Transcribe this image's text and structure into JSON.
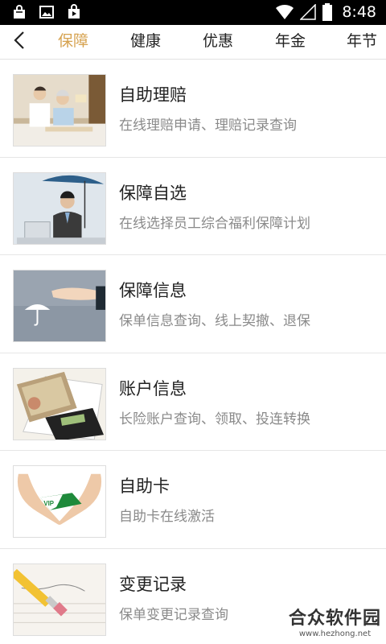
{
  "status_bar": {
    "time": "8:48",
    "left_icons": [
      "bag-icon",
      "image-icon",
      "play-store-icon"
    ],
    "right_icons": [
      "wifi-icon",
      "signal-icon",
      "battery-icon"
    ]
  },
  "nav": {
    "back_icon": "chevron-left-icon",
    "tabs": [
      {
        "label": "保障",
        "active": true
      },
      {
        "label": "健康",
        "active": false
      },
      {
        "label": "优惠",
        "active": false
      },
      {
        "label": "年金",
        "active": false
      },
      {
        "label": "年节",
        "active": false
      }
    ],
    "accent_color": "#d6a24f"
  },
  "items": [
    {
      "title": "自助理赔",
      "subtitle": "在线理赔申请、理赔记录查询",
      "image": "elderly-couple-photo"
    },
    {
      "title": "保障自选",
      "subtitle": "在线选择员工综合福利保障计划",
      "image": "businessman-umbrella-photo"
    },
    {
      "title": "保障信息",
      "subtitle": "保单信息查询、线上契撤、退保",
      "image": "hand-umbrella-photo"
    },
    {
      "title": "账户信息",
      "subtitle": "长险账户查询、领取、投连转换",
      "image": "cash-calculator-photo"
    },
    {
      "title": "自助卡",
      "subtitle": "自助卡在线激活",
      "image": "hands-vip-card-photo"
    },
    {
      "title": "变更记录",
      "subtitle": "保单变更记录查询",
      "image": "pencil-paper-photo"
    }
  ],
  "watermark": {
    "text": "合众软件园",
    "url": "www.hezhong.net"
  }
}
